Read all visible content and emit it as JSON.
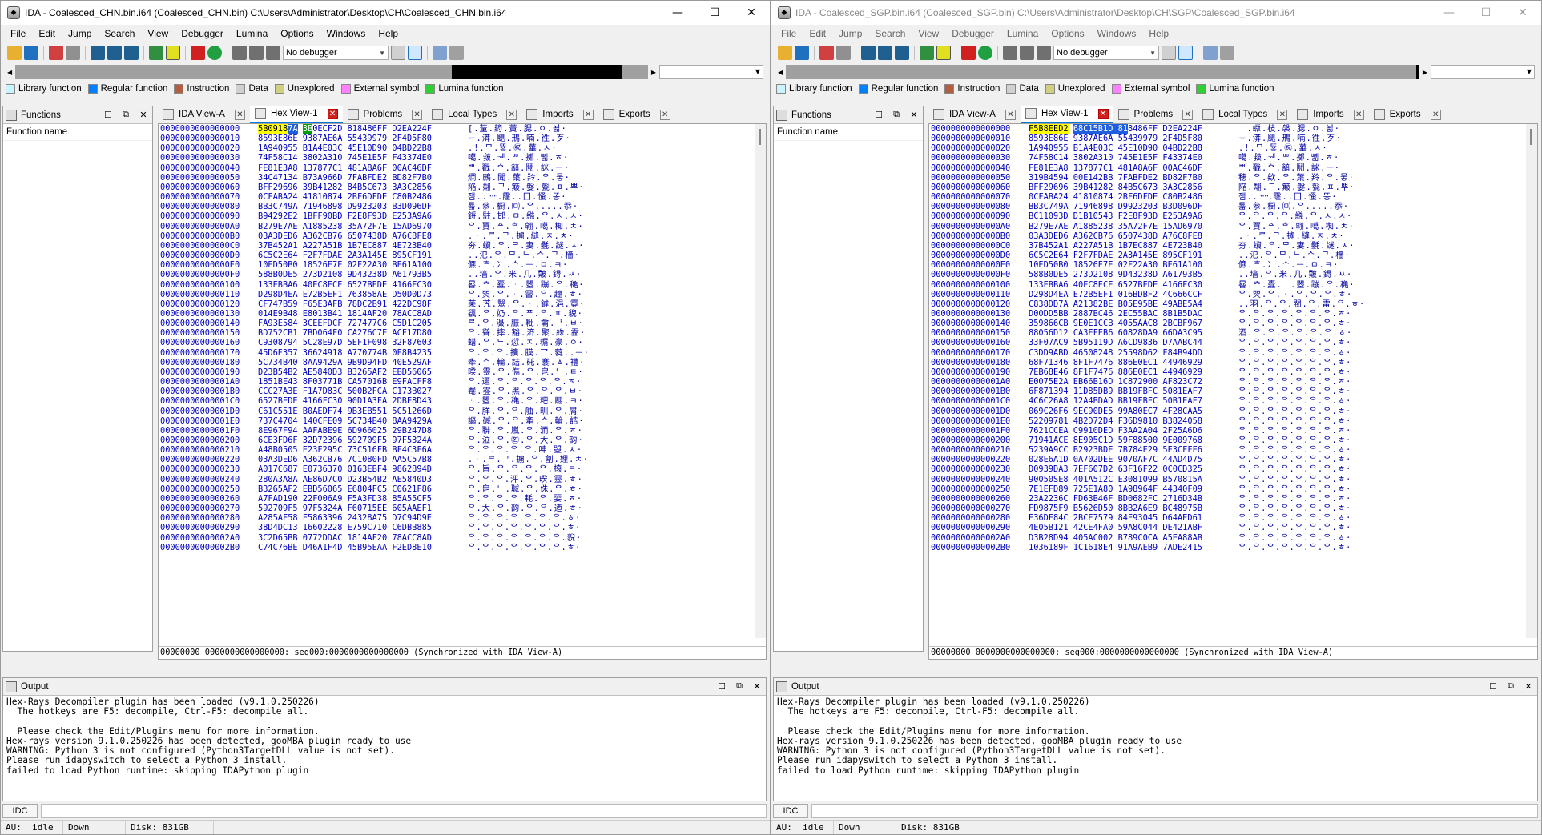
{
  "left": {
    "title": "IDA - Coalesced_CHN.bin.i64 (Coalesced_CHN.bin) C:\\Users\\Administrator\\Desktop\\CH\\Coalesced_CHN.bin.i64",
    "hex_status": "00000000 0000000000000000: seg000:0000000000000000 (Synchronized with IDA View-A)",
    "rows": [
      {
        "a": "0000000000000000",
        "b": [
          {
            "t": "5B0918",
            "c": "hl-yellow"
          },
          {
            "t": "7A",
            "c": "hl-blue"
          },
          {
            "t": " "
          },
          {
            "t": "3B",
            "c": "hl-green"
          },
          {
            "t": "0ECF2D 818486FF D2EA224F"
          }
        ],
        "s": "[.蕫.箹.蕢.腮.ㅇ.뇗·"
      },
      {
        "a": "0000000000000010",
        "b": [
          {
            "t": "8593E86E 9387AE6A 55439979 2F4D5F80"
          }
        ],
        "s": "ᅲ.漭.颶.鳽.喃.徃.歹·"
      },
      {
        "a": "0000000000000020",
        "b": [
          {
            "t": "1A940955 B1A4E03C 45E10D90 04BD22B8"
          }
        ],
        "s": ".!.ᄆ.뜧.㊗.蓽.ㅅ·"
      },
      {
        "a": "0000000000000030",
        "b": [
          {
            "t": "74F58C14 3802A310 745E1E5F F43374E0"
          }
        ],
        "s": "噶.皳.ᅰ.ᄈ.擲.뼯.ㅎ·"
      },
      {
        "a": "0000000000000040",
        "b": [
          {
            "t": "FE81E3A8 137877C1 481A8A6F 00AC46DF"
          }
        ],
        "s": "ᄈ.戳.ᅌ.韽.鬩.詸.ㅡ·"
      },
      {
        "a": "0000000000000050",
        "b": [
          {
            "t": "34C47134 B73A966D 7FABFDE2 BD82F7B0"
          }
        ],
        "s": "熌.鶊.聞.葉.羚.ᄋ.뭏·"
      },
      {
        "a": "0000000000000060",
        "b": [
          {
            "t": "BFF29696 39B41282 84B5C673 3A3C2856"
          }
        ],
        "s": "陥.翷.ᄀ.簸.媻.甏.ㅍ.뿌·"
      },
      {
        "a": "0000000000000070",
        "b": [
          {
            "t": "0CFABA24 41810874 2BF6DFDE C80B2486"
          }
        ],
        "s": "잼..᠁.霳..囗.慅.똥·"
      },
      {
        "a": "0000000000000080",
        "b": [
          {
            "t": "BB3C749A 71946898 D9923203 B3D096DF"
          }
        ],
        "s": "룗.叅.橱.㈄.ᄋ.....忝·"
      },
      {
        "a": "0000000000000090",
        "b": [
          {
            "t": "B94292E2 1BFF90BD F2E8F93D E253A9A6"
          }
        ],
        "s": "鋝.駐.邯.ㅁ.繈.ᄋ.ㅅ.ㅅ·"
      },
      {
        "a": "00000000000000A0",
        "b": [
          {
            "t": "B279E7AE A1885238 35A72F7E 15AD6970"
          }
        ],
        "s": "ᄋ.賈.ᅀ.ᄒ.翶.噶.椥.ㅊ·"
      },
      {
        "a": "00000000000000B0",
        "b": [
          {
            "t": "03A3DED6 A362CB76 6507438D A76C8FE8"
          }
        ],
        "s": ".ᆞ.ᄅ.ᄀ.擄.縫.ㅈ.ㅊ·"
      },
      {
        "a": "00000000000000C0",
        "b": [
          {
            "t": "37B452A1 A227A51B 1B7EC887 4E723B40"
          }
        ],
        "s": "夯.蠀.ᄋ.ᄆ.妻.氎.謎.ㅅ·"
      },
      {
        "a": "00000000000000D0",
        "b": [
          {
            "t": "6C5C2E64 F2F7FDAE 2A3A145E 895CF191"
          }
        ],
        "s": "..氾.ᄋ.ᄆ.ᄂ.ᄉ.ᄀ.檣·"
      },
      {
        "a": "00000000000000E0",
        "b": [
          {
            "t": "10ED50B0 18526E7E 02F22A30 BE61A100"
          }
        ],
        "s": "儦.ᄒ.冫.ᄉ.ᅳ.ㅁ.ㅋ·"
      },
      {
        "a": "00000000000000F0",
        "b": [
          {
            "t": "588B0DE5 273D2108 9D43238D A61793B5"
          }
        ],
        "s": "..墙.ᄋ.米.几.皾.鍀.ㅆ·"
      },
      {
        "a": "0000000000000100",
        "b": [
          {
            "t": "133EBBA6 40EC8ECE 6527BEDE 4166FC30"
          }
        ],
        "s": "晷.ᄎ.蠹.ᆞ.瞾.蹦.ᄋ.穐·"
      },
      {
        "a": "0000000000000110",
        "b": [
          {
            "t": "D298D4EA E72B5EF1 763858AE D50D0D73"
          }
        ],
        "s": "ᄋ.焸.ᄋ.ᆞ.霤.ᄋ.趢.ㅎ·"
      },
      {
        "a": "0000000000000120",
        "b": [
          {
            "t": "CF747B59 F65E3AFB 78DC2B91 422DC98F"
          }
        ],
        "s": "苿.苀.毉.ᄋ.ᆞ.鎼.浥.霓·"
      },
      {
        "a": "0000000000000130",
        "b": [
          {
            "t": "014E9B48 E8013B41 1814AF20 78ACC8AD"
          }
        ],
        "s": "颻.ᄋ.奶.ᄋ.ᄑ.ᄋ.ㅍ.貎·"
      },
      {
        "a": "0000000000000140",
        "b": [
          {
            "t": "FA93E584 3CEEFDCF 727477C6 C5D1C205"
          }
        ],
        "s": "ᄅ.ᄋ.滠.脤.粃.龠.ᅧ.ㅂ·"
      },
      {
        "a": "0000000000000150",
        "b": [
          {
            "t": "BD752CB1 7BD064F0 CA276C7F ACF17D80"
          }
        ],
        "s": "ᄋ.聳.摔.豁.济.聚.絑.霝·"
      },
      {
        "a": "0000000000000160",
        "b": [
          {
            "t": "C9308794 5C28E97D 5EF1F098 32F87603"
          }
        ],
        "s": "蜡.ᄋ.ᄂ.愆.ㅈ.糏.豪.ㅇ·"
      },
      {
        "a": "0000000000000170",
        "b": [
          {
            "t": "45D6E357 36624918 A770774B 0E8B4235"
          }
        ],
        "s": "ᄋ.ᄋ.ᄋ.擴.膜.乛.蕤..ᅳ·"
      },
      {
        "a": "0000000000000180",
        "b": [
          {
            "t": "5C734B40 8AA9429A 9B9D94FD 40E529AF"
          }
        ],
        "s": "牽.ᄉ.輪.詰.矺.褰.ㅿ.禮·"
      },
      {
        "a": "0000000000000190",
        "b": [
          {
            "t": "D23B54B2 AE5840D3 B3265AF2 EBD56065"
          }
        ],
        "s": "暌.靈.ᄋ.儁.ᄋ.皀.ᄂ.ㅌ·"
      },
      {
        "a": "00000000000001A0",
        "b": [
          {
            "t": "1851BE43 8F03771B CA57016B E9FACFF8"
          }
        ],
        "s": "ᄋ.邇.ᄋ.ᄋ.ᄋ.ᄋ.ᄋ.ㅎ·"
      },
      {
        "a": "00000000000001B0",
        "b": [
          {
            "t": "CCC27A3E F1A7D83C 500B2FCA C173B027"
          }
        ],
        "s": "罨.霯.ᄋ.黑.ᄋ.ᄋ.ᄋ.ㅂ·"
      },
      {
        "a": "00000000000001C0",
        "b": [
          {
            "t": "6527BEDE 4166FC30 90D1A3FA 2DBE8D43"
          }
        ],
        "s": "ᆞ.瞾.ᄋ.穐.ᄋ.粑.翢.ㅋ·"
      },
      {
        "a": "00000000000001D0",
        "b": [
          {
            "t": "C61C551E B0AEDF74 9B3EB551 5C51266D"
          }
        ],
        "s": "ᄋ.羘.ᄋ.ᄋ.舳.甽.ᄋ.屑·"
      },
      {
        "a": "00000000000001E0",
        "b": [
          {
            "t": "737C4704 140CFE09 5C734B40 8AA9429A"
          }
        ],
        "s": "謳.碱.ᄋ.ᄋ.牽.ᄉ.輪.詰·"
      },
      {
        "a": "00000000000001F0",
        "b": [
          {
            "t": "8E967F94 AAFABE9E 6D966025 29B247D8"
          }
        ],
        "s": "ᄋ.聨.ᄋ.嵐.ᄋ.洏.ᄋ.ㅎ·"
      },
      {
        "a": "0000000000000200",
        "b": [
          {
            "t": "6CE3FD6F 32D72396 592709F5 97F5324A"
          }
        ],
        "s": "ᄋ.泣.ᄋ.㊔.ᄋ.大.ᄋ.韵·"
      },
      {
        "a": "0000000000000210",
        "b": [
          {
            "t": "A48B0505 E23F295C 73C516FB BF4C3F6A"
          }
        ],
        "s": "ᄋ.ᄋ.ᄋ.ᄋ.ᄋ.呻.曌.ㅊ·"
      },
      {
        "a": "0000000000000220",
        "b": [
          {
            "t": "03A3DED6 A362CB76 7C1080FD AA5C57B8"
          }
        ],
        "s": ".ᆞ.ᄅ.ᄀ.擄.ᄋ.劊.娌.ㅊ·"
      },
      {
        "a": "0000000000000230",
        "b": [
          {
            "t": "A017C687 E0736370 0163EBF4 9862894D"
          }
        ],
        "s": "ᄋ.旨.ᄋ.ᄋ.ᄋ.ᄋ.榱.ㅋ·"
      },
      {
        "a": "0000000000000240",
        "b": [
          {
            "t": "280A3A8A AE86D7C0 D23B54B2 AE5840D3"
          }
        ],
        "s": "ᄋ.ᄋ.ᄋ.泙.ᄋ.暌.靈.ㅎ·"
      },
      {
        "a": "0000000000000250",
        "b": [
          {
            "t": "B3265AF2 EBD56065 E6804FC5 C0621F86"
          }
        ],
        "s": "ᄋ.皀.ᄂ.聝.ᄋ.侏.ᄋ.ㅎ·"
      },
      {
        "a": "0000000000000260",
        "b": [
          {
            "t": "A7FAD190 22F006A9 F5A3FD38 85A55CF5"
          }
        ],
        "s": "ᄋ.ᄋ.ᄋ.ᄋ.耗.ᄋ.婯.ㅎ·"
      },
      {
        "a": "0000000000000270",
        "b": [
          {
            "t": "592709F5 97F5324A F60715EE 605AAEF1"
          }
        ],
        "s": "ᄋ.大.ᄋ.韵.ᄋ.ᄋ.迺.ㅎ·"
      },
      {
        "a": "0000000000000280",
        "b": [
          {
            "t": "A285AF58 F5863396 24328A75 D7C94D9E"
          }
        ],
        "s": "ᄋ.ᄋ.ᄋ.ᄋ.ᄋ.ᄋ.ᄋ.ㅎ·"
      },
      {
        "a": "0000000000000290",
        "b": [
          {
            "t": "38D4DC13 16602228 E759C710 C6DBB885"
          }
        ],
        "s": "ᄋ.ᄋ.ᄋ.ᄋ.ᄋ.ᄋ.ᄋ.ㅎ·"
      },
      {
        "a": "00000000000002A0",
        "b": [
          {
            "t": "3C2D65BB 0772DDAC 1814AF20 78ACC8AD"
          }
        ],
        "s": "ᄋ.ᄋ.ᄋ.ᄋ.ᄋ.ᄋ.ᄋ.貎·"
      },
      {
        "a": "00000000000002B0",
        "b": [
          {
            "t": "C74C76BE D46A1F4D 45B95EAA F2ED8E10"
          }
        ],
        "s": "ᄋ.ᄋ.ᄋ.ᄋ.ᄋ.ᄋ.ᄋ.ㅎ·"
      }
    ]
  },
  "right": {
    "title": "IDA - Coalesced_SGP.bin.i64 (Coalesced_SGP.bin) C:\\Users\\Administrator\\Desktop\\CH\\SGP\\Coalesced_SGP.bin.i64",
    "hex_status": "00000000 0000000000000000: seg000:0000000000000000 (Synchronized with IDA View-A)",
    "rows": [
      {
        "a": "0000000000000000",
        "b": [
          {
            "t": "F5B8EED2",
            "c": "hl-yellow"
          },
          {
            "t": " "
          },
          {
            "t": "68C15B1D 81",
            "c": "hl-blue"
          },
          {
            "t": "8486FF D2EA224F"
          }
        ],
        "s": "ᆞ.蝂.枝.褩.腮.ㅇ.뇗·"
      },
      {
        "a": "0000000000000010",
        "b": [
          {
            "t": "8593E86E 9387AE6A 55439979 2F4D5F80"
          }
        ],
        "s": "ᅲ.漭.颶.鳽.喃.徃.歹·"
      },
      {
        "a": "0000000000000020",
        "b": [
          {
            "t": "1A940955 B1A4E03C 45E10D90 04BD22B8"
          }
        ],
        "s": ".!.ᄆ.뜧.㊗.蓽.ㅅ·"
      },
      {
        "a": "0000000000000030",
        "b": [
          {
            "t": "74F58C14 3802A310 745E1E5F F43374E0"
          }
        ],
        "s": "噶.皳.ᅰ.ᄈ.擲.뼯.ㅎ·"
      },
      {
        "a": "0000000000000040",
        "b": [
          {
            "t": "FE81E3A8 137877C1 481A8A6F 00AC46DF"
          }
        ],
        "s": "ᄈ.戳.ᅌ.韽.鬩.詸.ㅡ·"
      },
      {
        "a": "0000000000000050",
        "b": [
          {
            "t": "319B4594 00E142BB 7FABFDE2 BD82F7B0"
          }
        ],
        "s": "穂.ᄋ.欸.ᄋ.葉.羚.ᄋ.뭏·"
      },
      {
        "a": "0000000000000060",
        "b": [
          {
            "t": "BFF29696 39B41282 84B5C673 3A3C2856"
          }
        ],
        "s": "陥.翷.ᄀ.簸.媻.甏.ㅍ.뿌·"
      },
      {
        "a": "0000000000000070",
        "b": [
          {
            "t": "0CFABA24 41810874 2BF6DFDE C80B2486"
          }
        ],
        "s": "잼..᠁.霳..囗.慅.똥·"
      },
      {
        "a": "0000000000000080",
        "b": [
          {
            "t": "BB3C749A 71946898 D9923203 B3D096DF"
          }
        ],
        "s": "룗.叅.橱.㈄.ᄋ.....忝·"
      },
      {
        "a": "0000000000000090",
        "b": [
          {
            "t": "BC11093D D1B10543 F2E8F93D E253A9A6"
          }
        ],
        "s": "ᄋ.ᄋ.ᄋ.ᄋ.繈.ᄋ.ㅅ.ㅅ·"
      },
      {
        "a": "00000000000000A0",
        "b": [
          {
            "t": "B279E7AE A1885238 35A72F7E 15AD6970"
          }
        ],
        "s": "ᄋ.賈.ᅀ.ᄒ.翶.噶.椥.ㅊ·"
      },
      {
        "a": "00000000000000B0",
        "b": [
          {
            "t": "03A3DED6 A362CB76 6507438D A76C8FE8"
          }
        ],
        "s": ".ᆞ.ᄅ.ᄀ.擄.縫.ㅈ.ㅊ·"
      },
      {
        "a": "00000000000000C0",
        "b": [
          {
            "t": "37B452A1 A227A51B 1B7EC887 4E723B40"
          }
        ],
        "s": "夯.蠀.ᄋ.ᄆ.妻.氎.謎.ㅅ·"
      },
      {
        "a": "00000000000000D0",
        "b": [
          {
            "t": "6C5C2E64 F2F7FDAE 2A3A145E 895CF191"
          }
        ],
        "s": "..氾.ᄋ.ᄆ.ᄂ.ᄉ.ᄀ.檣·"
      },
      {
        "a": "00000000000000E0",
        "b": [
          {
            "t": "10ED50B0 18526E7E 02F22A30 BE61A100"
          }
        ],
        "s": "儦.ᄒ.冫.ᄉ.ᅳ.ㅁ.ㅋ·"
      },
      {
        "a": "00000000000000F0",
        "b": [
          {
            "t": "588B0DE5 273D2108 9D43238D A61793B5"
          }
        ],
        "s": "..墙.ᄋ.米.几.皾.鍀.ㅆ·"
      },
      {
        "a": "0000000000000100",
        "b": [
          {
            "t": "133EBBA6 40EC8ECE 6527BEDE 4166FC30"
          }
        ],
        "s": "晷.ᄎ.蠹.ᆞ.瞾.蹦.ᄋ.穐·"
      },
      {
        "a": "0000000000000110",
        "b": [
          {
            "t": "D298D4EA E72B5EF1 016BDBF2 4C666CCF"
          }
        ],
        "s": "ᄋ.焸.ᄋ.ᆞ.ᄋ.ᄋ.ᄋ.ㅎ·"
      },
      {
        "a": "0000000000000120",
        "b": [
          {
            "t": "C838DD7A A21382BE B05E95BE 49ABE5A4"
          }
        ],
        "s": "..羽.ᄋ.ᄋ.閥.ᄋ.雷.ᄋ.ㅎ·"
      },
      {
        "a": "0000000000000130",
        "b": [
          {
            "t": "D00DD5BB 2887BC46 2EC55BAC 8B1B5DAC"
          }
        ],
        "s": "ᄋ.ᄋ.ᄋ.ᄋ.ᄋ.ᄋ.ᄋ.ㅎ·"
      },
      {
        "a": "0000000000000140",
        "b": [
          {
            "t": "359866CB 9E0E1CCB 4055AAC8 2BCBF967"
          }
        ],
        "s": "ᄋ.ᄋ.ᄋ.ᄋ.ᄋ.ᄋ.ᄋ.ㅎ·"
      },
      {
        "a": "0000000000000150",
        "b": [
          {
            "t": "88056D12 CA3EFEB6 60828DA9 66DA3C95"
          }
        ],
        "s": "酒.ᄋ.ᄋ.ᄋ.ᄋ.ᄋ.ᄋ.ㅎ·"
      },
      {
        "a": "0000000000000160",
        "b": [
          {
            "t": "33F07AC9 5B95119D A6CD9836 D7AABC44"
          }
        ],
        "s": "ᄋ.ᄋ.ᄋ.ᄋ.ᄋ.ᄋ.ᄋ.ㅎ·"
      },
      {
        "a": "0000000000000170",
        "b": [
          {
            "t": "C3DD9ABD 46508248 25598D62 F84B94DD"
          }
        ],
        "s": "ᄋ.ᄋ.ᄋ.ᄋ.ᄋ.ᄋ.ᄋ.ㅎ·"
      },
      {
        "a": "0000000000000180",
        "b": [
          {
            "t": "68F71346 8F1F7476 886E0EC1 44946929"
          }
        ],
        "s": "ᄋ.ᄋ.ᄋ.ᄋ.ᄋ.ᄋ.ᄋ.ㅎ·"
      },
      {
        "a": "0000000000000190",
        "b": [
          {
            "t": "7EB68E46 8F1F7476 886E0EC1 44946929"
          }
        ],
        "s": "ᄋ.ᄋ.ᄋ.ᄋ.ᄋ.ᄋ.ᄋ.ㅎ·"
      },
      {
        "a": "00000000000001A0",
        "b": [
          {
            "t": "E0075E2A EB66B16D 1C872900 AF823C72"
          }
        ],
        "s": "ᄋ.ᄋ.ᄋ.ᄋ.ᄋ.ᄋ.ᄋ.ㅎ·"
      },
      {
        "a": "00000000000001B0",
        "b": [
          {
            "t": "6F871394 11D85DB9 BB19FBFC 5081EAF7"
          }
        ],
        "s": "ᄋ.ᄋ.ᄋ.ᄋ.ᄋ.ᄋ.ᄋ.ㅎ·"
      },
      {
        "a": "00000000000001C0",
        "b": [
          {
            "t": "4C6C26A8 12A4BDAD BB19FBFC 50B1EAF7"
          }
        ],
        "s": "ᄋ.ᄋ.ᄋ.ᄋ.ᄋ.ᄋ.ᄋ.ㅎ·"
      },
      {
        "a": "00000000000001D0",
        "b": [
          {
            "t": "069C26F6 9EC90DE5 99A80EC7 4F28CAA5"
          }
        ],
        "s": "ᄋ.ᄋ.ᄋ.ᄋ.ᄋ.ᄋ.ᄋ.ㅎ·"
      },
      {
        "a": "00000000000001E0",
        "b": [
          {
            "t": "52209781 4B2D72D4 F36D9810 B3824058"
          }
        ],
        "s": "ᄋ.ᄋ.ᄋ.ᄋ.ᄋ.ᄋ.ᄋ.ㅎ·"
      },
      {
        "a": "00000000000001F0",
        "b": [
          {
            "t": "7621CCEA C9910DED F3AA2A04 2F25A6D6"
          }
        ],
        "s": "ᄋ.ᄋ.ᄋ.ᄋ.ᄋ.ᄋ.ᄋ.ㅎ·"
      },
      {
        "a": "0000000000000200",
        "b": [
          {
            "t": "71941ACE 8E905C1D 59F88500 9E009768"
          }
        ],
        "s": "ᄋ.ᄋ.ᄋ.ᄋ.ᄋ.ᄋ.ᄋ.ㅎ·"
      },
      {
        "a": "0000000000000210",
        "b": [
          {
            "t": "5239A9CC B2923BDE 7B784E29 5E3CFFE6"
          }
        ],
        "s": "ᄋ.ᄋ.ᄋ.ᄋ.ᄋ.ᄋ.ᄋ.ㅎ·"
      },
      {
        "a": "0000000000000220",
        "b": [
          {
            "t": "028E6A1D 0A702DEE 9070AF7C 44AD4D75"
          }
        ],
        "s": "ᄋ.ᄋ.ᄋ.ᄋ.ᄋ.ᄋ.ᄋ.ㅎ·"
      },
      {
        "a": "0000000000000230",
        "b": [
          {
            "t": "D0939DA3 7EF607D2 63F16F22 0C0CD325"
          }
        ],
        "s": "ᄋ.ᄋ.ᄋ.ᄋ.ᄋ.ᄋ.ᄋ.ㅎ·"
      },
      {
        "a": "0000000000000240",
        "b": [
          {
            "t": "90050SE8 401A512C E3081099 B570815A"
          }
        ],
        "s": "ᄋ.ᄋ.ᄋ.ᄋ.ᄋ.ᄋ.ᄋ.ㅎ·"
      },
      {
        "a": "0000000000000250",
        "b": [
          {
            "t": "7E1EFD89 725E1A80 1A98964F 44340F09"
          }
        ],
        "s": "ᄋ.ᄋ.ᄋ.ᄋ.ᄋ.ᄋ.ᄋ.ㅎ·"
      },
      {
        "a": "0000000000000260",
        "b": [
          {
            "t": "23A2236C FD63B46F BD0682FC 2716D34B"
          }
        ],
        "s": "ᄋ.ᄋ.ᄋ.ᄋ.ᄋ.ᄋ.ᄋ.ㅎ·"
      },
      {
        "a": "0000000000000270",
        "b": [
          {
            "t": "FD9875F9 B5626D50 8BB2A6E9 BC48975B"
          }
        ],
        "s": "ᄋ.ᄋ.ᄋ.ᄋ.ᄋ.ᄋ.ᄋ.ㅎ·"
      },
      {
        "a": "0000000000000280",
        "b": [
          {
            "t": "E36DF84C 2BCE7579 84E93045 D64AED61"
          }
        ],
        "s": "ᄋ.ᄋ.ᄋ.ᄋ.ᄋ.ᄋ.ᄋ.ㅎ·"
      },
      {
        "a": "0000000000000290",
        "b": [
          {
            "t": "4E05B121 42CE4FA0 59A8C044 DE421ABF"
          }
        ],
        "s": "ᄋ.ᄋ.ᄋ.ᄋ.ᄋ.ᄋ.ᄋ.ㅎ·"
      },
      {
        "a": "00000000000002A0",
        "b": [
          {
            "t": "D3B28D94 405AC002 B789C0CA A5EA88AB"
          }
        ],
        "s": "ᄋ.ᄋ.ᄋ.ᄋ.ᄋ.ᄋ.ᄋ.ㅎ·"
      },
      {
        "a": "00000000000002B0",
        "b": [
          {
            "t": "1036189F 1C1618E4 91A9AEB9 7ADE2415"
          }
        ],
        "s": "ᄋ.ᄋ.ᄋ.ᄋ.ᄋ.ᄋ.ᄋ.ㅎ·"
      }
    ]
  },
  "shared": {
    "menu": [
      "File",
      "Edit",
      "Jump",
      "Search",
      "View",
      "Debugger",
      "Lumina",
      "Options",
      "Windows",
      "Help"
    ],
    "debugger_select": "No debugger",
    "legend": [
      {
        "label": "Library function",
        "color": "#c8f4ff"
      },
      {
        "label": "Regular function",
        "color": "#0080ff"
      },
      {
        "label": "Instruction",
        "color": "#b06040"
      },
      {
        "label": "Data",
        "color": "#d0d0d0"
      },
      {
        "label": "Unexplored",
        "color": "#d0d080"
      },
      {
        "label": "External symbol",
        "color": "#ff80ff"
      },
      {
        "label": "Lumina function",
        "color": "#30d030"
      }
    ],
    "functions_title": "Functions",
    "functions_col": "Function name",
    "tabs": [
      "IDA View-A",
      "Hex View-1",
      "Problems",
      "Local Types",
      "Imports",
      "Exports"
    ],
    "output_title": "Output",
    "output_lines": [
      "Hex-Rays Decompiler plugin has been loaded (v9.1.0.250226)",
      "  The hotkeys are F5: decompile, Ctrl-F5: decompile all.",
      "",
      "  Please check the Edit/Plugins menu for more information.",
      "Hex-rays version 9.1.0.250226 has been detected, gooMBA plugin ready to use",
      "WARNING: Python 3 is not configured (Python3TargetDLL value is not set).",
      "Please run idapyswitch to select a Python 3 install.",
      "failed to load Python runtime: skipping IDAPython plugin"
    ],
    "idc_label": "IDC",
    "status": {
      "au": "AU:  idle",
      "dir": "Down",
      "disk": "Disk: 831GB"
    }
  }
}
